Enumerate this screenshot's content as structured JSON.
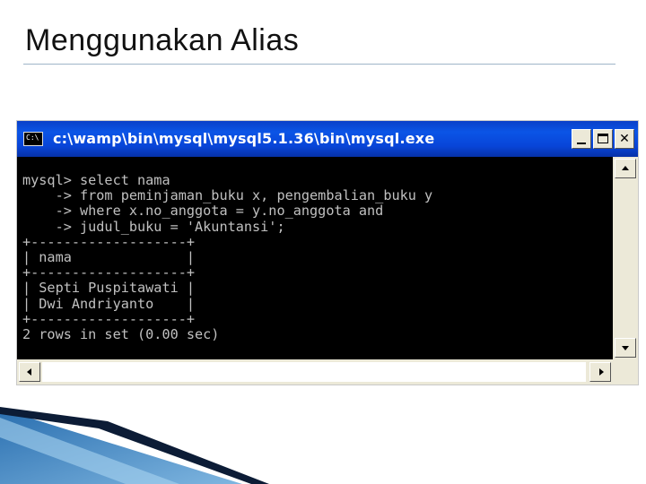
{
  "slide": {
    "title": "Menggunakan Alias"
  },
  "window": {
    "title": "c:\\wamp\\bin\\mysql\\mysql5.1.36\\bin\\mysql.exe",
    "icon": "console-app-icon",
    "controls": {
      "minimize_icon": "minimize-icon",
      "maximize_icon": "maximize-icon",
      "close_icon": "close-icon"
    }
  },
  "console": {
    "text": "mysql> select nama\n    -> from peminjaman_buku x, pengembalian_buku y\n    -> where x.no_anggota = y.no_anggota and\n    -> judul_buku = 'Akuntansi';\n+-------------------+\n| nama              |\n+-------------------+\n| Septi Puspitawati |\n| Dwi Andriyanto    |\n+-------------------+\n2 rows in set (0.00 sec)",
    "foreground": "#c0c0c0",
    "background": "#000000"
  },
  "colors": {
    "titlebar": "#0b55e6",
    "chrome": "#ece9d8",
    "rule": "#9fb5c8"
  }
}
